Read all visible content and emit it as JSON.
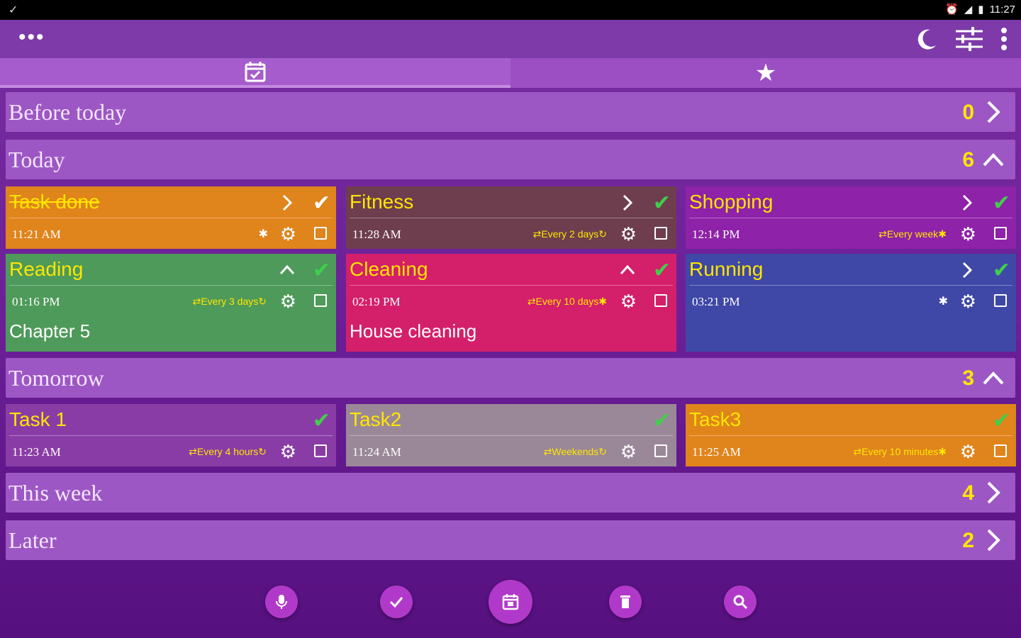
{
  "status_bar": {
    "time": "11:27"
  },
  "tabs": [
    {
      "icon": "calendar-check-icon"
    },
    {
      "icon": "star-icon"
    }
  ],
  "sections": {
    "before_today": {
      "title": "Before today",
      "count": "0"
    },
    "today": {
      "title": "Today",
      "count": "6"
    },
    "tomorrow": {
      "title": "Tomorrow",
      "count": "3"
    },
    "this_week": {
      "title": "This week",
      "count": "4"
    },
    "later": {
      "title": "Later",
      "count": "2"
    }
  },
  "today_tasks": [
    {
      "title": "Task done",
      "time": "11:21 AM",
      "repeat": "",
      "color": "#e0841c"
    },
    {
      "title": "Fitness",
      "time": "11:28 AM",
      "repeat": "⇄Every 2 days↻",
      "color": "#6e3e4e"
    },
    {
      "title": "Shopping",
      "time": "12:14 PM",
      "repeat": "⇄Every week✱",
      "color": "#8e22a8"
    },
    {
      "title": "Reading",
      "time": "01:16 PM",
      "repeat": "⇄Every 3 days↻",
      "note": "Chapter 5",
      "color": "#4e9a5a"
    },
    {
      "title": "Cleaning",
      "time": "02:19 PM",
      "repeat": "⇄Every 10 days✱",
      "note": "House cleaning",
      "color": "#d41f6a"
    },
    {
      "title": "Running",
      "time": "03:21 PM",
      "repeat": "",
      "color": "#3f48a6"
    }
  ],
  "tomorrow_tasks": [
    {
      "title": "Task 1",
      "time": "11:23 AM",
      "repeat": "⇄Every 4 hours↻",
      "color": "#8a3ca6"
    },
    {
      "title": "Task2",
      "time": "11:24 AM",
      "repeat": "⇄Weekends↻",
      "color": "#9a8898"
    },
    {
      "title": "Task3",
      "time": "11:25 AM",
      "repeat": "⇄Every 10 minutes✱",
      "color": "#e0841c"
    }
  ],
  "fabs": [
    "microphone-icon",
    "check-icon",
    "calendar-icon",
    "trash-icon",
    "search-icon"
  ]
}
